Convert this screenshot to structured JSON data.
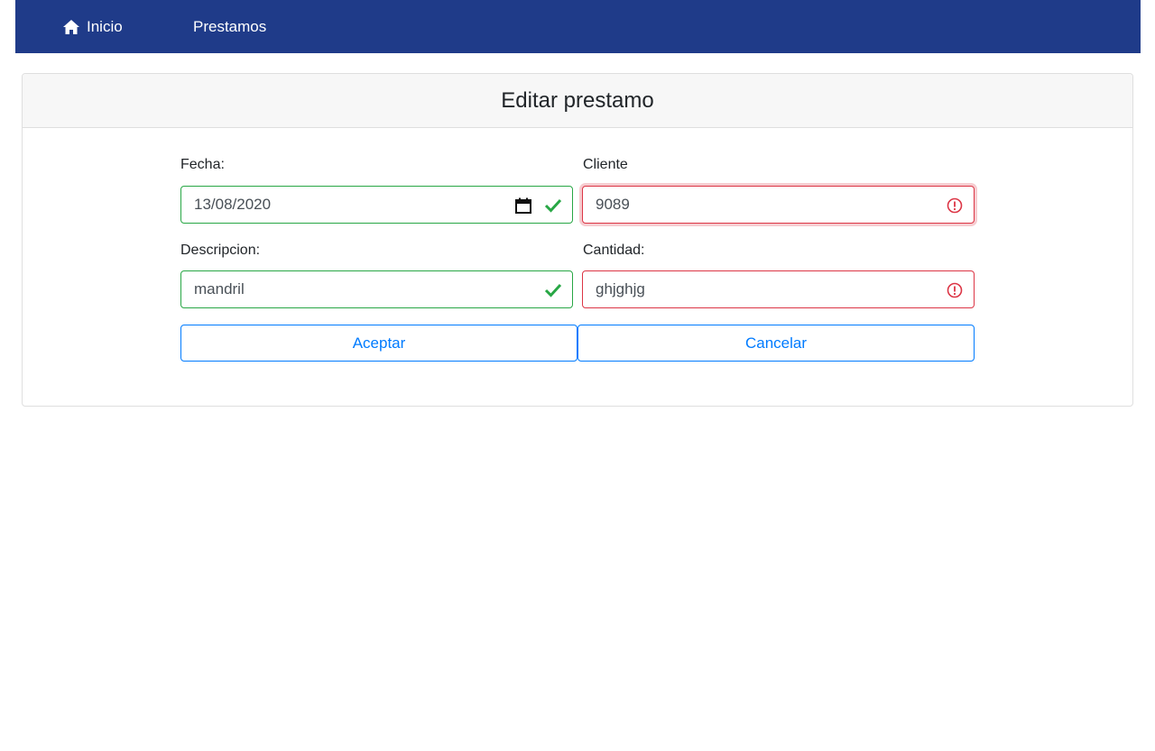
{
  "nav": {
    "home_label": "Inicio",
    "prestamos_label": "Prestamos",
    "background": "#1f3b89"
  },
  "form": {
    "title": "Editar prestamo",
    "fecha": {
      "label": "Fecha:",
      "value": "13/08/2020",
      "state": "valid"
    },
    "cliente": {
      "label": "Cliente",
      "value": "9089",
      "state": "invalid"
    },
    "descripcion": {
      "label": "Descripcion:",
      "value": "mandril",
      "state": "valid"
    },
    "cantidad": {
      "label": "Cantidad:",
      "value": "ghjghjg",
      "state": "invalid"
    },
    "accept_label": "Aceptar",
    "cancel_label": "Cancelar"
  },
  "colors": {
    "valid": "#28a745",
    "invalid": "#dc3545",
    "primary": "#007bff"
  }
}
